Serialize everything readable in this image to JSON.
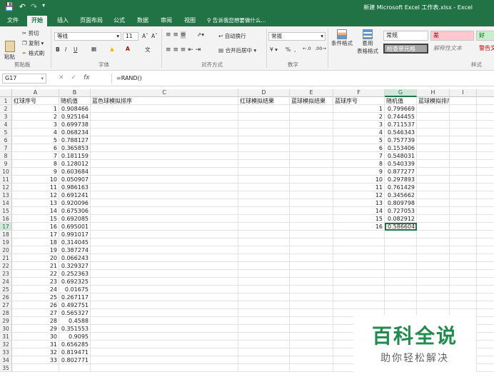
{
  "titlebar": {
    "title": "新建 Microsoft Excel 工作表.xlsx - Excel",
    "save_icon": "save-icon",
    "undo_icon": "undo-icon",
    "redo_icon": "redo-icon"
  },
  "tabs": [
    "文件",
    "开始",
    "插入",
    "页面布局",
    "公式",
    "数据",
    "审阅",
    "视图"
  ],
  "active_tab": "开始",
  "tell_me": "告诉我您想要做什么...",
  "ribbon": {
    "paste": "粘贴",
    "cut": "剪切",
    "copy": "复制",
    "format_painter": "格式刷",
    "clipboard_label": "剪贴板",
    "font_name": "等线",
    "font_size": "11",
    "font_label": "字体",
    "wrap_text": "自动换行",
    "merge_center": "合并后居中",
    "align_label": "对齐方式",
    "number_format": "常规",
    "number_label": "数字",
    "cond_format": "条件格式",
    "table_format_1": "套用",
    "table_format_2": "表格格式",
    "styles_label": "样式",
    "style_normal": "常规",
    "style_bad": "差",
    "style_good": "好",
    "style_check": "检查单元格",
    "style_explain": "解释性文本",
    "style_warning": "警告文"
  },
  "formula_bar": {
    "name_box": "G17",
    "formula": "=RAND()"
  },
  "columns": [
    "A",
    "B",
    "C",
    "D",
    "E",
    "F",
    "G",
    "H",
    "I"
  ],
  "selected_column": "G",
  "selected_row": 17,
  "headers": {
    "A": "红球序号",
    "B": "随机值",
    "C": "蓝色球模拟排序",
    "D": "红球模拟结果",
    "E": "蓝球模拟结果",
    "F": "蓝球序号",
    "G": "随机值",
    "H": "蓝球模拟排序"
  },
  "red_rows": [
    [
      "1",
      "0.908466"
    ],
    [
      "2",
      "0.925164"
    ],
    [
      "3",
      "0.699738"
    ],
    [
      "4",
      "0.068234"
    ],
    [
      "5",
      "0.788127"
    ],
    [
      "6",
      "0.365853"
    ],
    [
      "7",
      "0.181159"
    ],
    [
      "8",
      "0.128012"
    ],
    [
      "9",
      "0.603684"
    ],
    [
      "10",
      "0.050907"
    ],
    [
      "11",
      "0.986163"
    ],
    [
      "12",
      "0.691241"
    ],
    [
      "13",
      "0.920096"
    ],
    [
      "14",
      "0.675306"
    ],
    [
      "15",
      "0.692085"
    ],
    [
      "16",
      "0.695001"
    ],
    [
      "17",
      "0.991017"
    ],
    [
      "18",
      "0.314045"
    ],
    [
      "19",
      "0.387274"
    ],
    [
      "20",
      "0.066243"
    ],
    [
      "21",
      "0.329327"
    ],
    [
      "22",
      "0.252363"
    ],
    [
      "23",
      "0.692325"
    ],
    [
      "24",
      "0.01675"
    ],
    [
      "25",
      "0.267117"
    ],
    [
      "26",
      "0.492751"
    ],
    [
      "27",
      "0.565327"
    ],
    [
      "28",
      "0.4588"
    ],
    [
      "29",
      "0.351553"
    ],
    [
      "30",
      "0.9095"
    ],
    [
      "31",
      "0.656285"
    ],
    [
      "32",
      "0.819471"
    ],
    [
      "33",
      "0.802771"
    ]
  ],
  "blue_rows": [
    [
      "1",
      "0.799669"
    ],
    [
      "2",
      "0.744455"
    ],
    [
      "3",
      "0.711537"
    ],
    [
      "4",
      "0.546343"
    ],
    [
      "5",
      "0.757739"
    ],
    [
      "6",
      "0.153406"
    ],
    [
      "7",
      "0.548031"
    ],
    [
      "8",
      "0.540339"
    ],
    [
      "9",
      "0.877277"
    ],
    [
      "10",
      "0.297893"
    ],
    [
      "11",
      "0.761429"
    ],
    [
      "12",
      "0.345662"
    ],
    [
      "13",
      "0.809798"
    ],
    [
      "14",
      "0.727053"
    ],
    [
      "15",
      "0.082912"
    ],
    [
      "16",
      "0.586604"
    ]
  ],
  "row_numbers": [
    "1",
    "2",
    "3",
    "4",
    "5",
    "6",
    "7",
    "8",
    "9",
    "10",
    "11",
    "12",
    "13",
    "14",
    "15",
    "16",
    "17",
    "18",
    "19",
    "20",
    "21",
    "22",
    "23",
    "24",
    "25",
    "26",
    "27",
    "28",
    "29",
    "30",
    "31",
    "32",
    "33",
    "34",
    "35"
  ],
  "watermark": {
    "big": "百科全说",
    "small": "助你轻松解决"
  },
  "colors": {
    "accent": "#217346",
    "bad_fill": "#ffc7ce",
    "good_fill": "#c6efce",
    "check_fill": "#a5a5a5"
  }
}
